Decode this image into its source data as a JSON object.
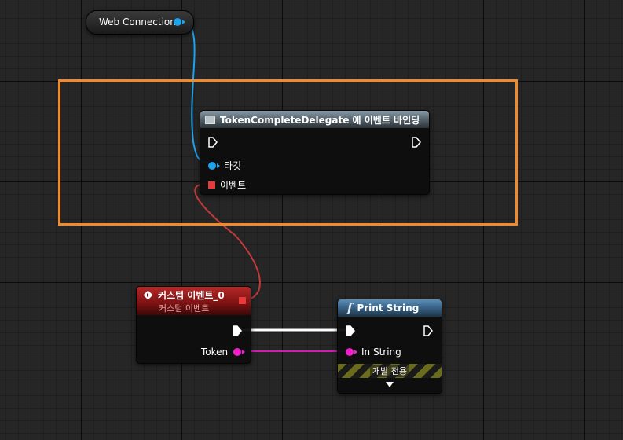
{
  "web_connection": {
    "label": "Web Connection"
  },
  "bind_node": {
    "title": "TokenCompleteDelegate 에 이벤트 바인딩",
    "pin_target": "타깃",
    "pin_event": "이벤트"
  },
  "custom_event": {
    "title": "커스텀 이벤트_0",
    "subtitle": "커스텀 이벤트",
    "pin_token": "Token"
  },
  "print_string": {
    "title": "Print String",
    "pin_in_string": "In String",
    "dev_only": "개발 전용",
    "function_glyph": "f"
  },
  "colors": {
    "object_pin": "#1ca3ec",
    "delegate_pin": "#e83a3a",
    "string_pin": "#f020c8",
    "exec": "#ffffff",
    "selection": "#f08a2a"
  }
}
